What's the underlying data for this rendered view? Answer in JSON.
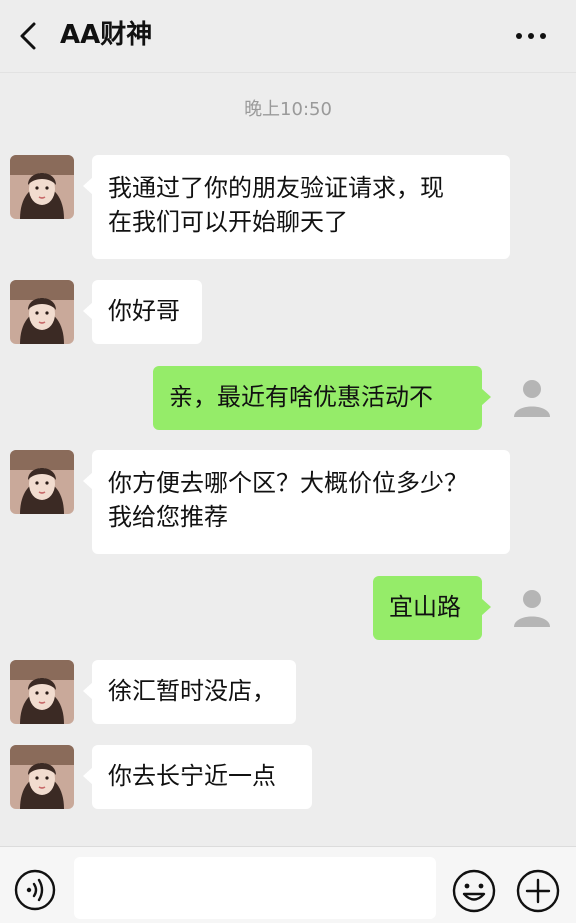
{
  "header": {
    "title": "AA财神"
  },
  "timestamp": "晚上10:50",
  "messages": [
    {
      "side": "left",
      "lines": [
        "我通过了你的朋友验证请求，现",
        "在我们可以开始聊天了"
      ]
    },
    {
      "side": "left",
      "lines": [
        "你好哥"
      ]
    },
    {
      "side": "right",
      "lines": [
        "亲，最近有啥优惠活动不"
      ]
    },
    {
      "side": "left",
      "lines": [
        "你方便去哪个区？大概价位多少？",
        "我给您推荐"
      ]
    },
    {
      "side": "right",
      "lines": [
        "宜山路"
      ]
    },
    {
      "side": "left",
      "lines": [
        "徐汇暂时没店，"
      ]
    },
    {
      "side": "left",
      "lines": [
        "你去长宁近一点"
      ]
    }
  ],
  "icons": {
    "back": "chevron-left-icon",
    "more": "more-dots-icon",
    "voice": "voice-icon",
    "emoji": "emoji-icon",
    "plus": "plus-icon"
  },
  "colors": {
    "background": "#ededed",
    "bubble_received": "#ffffff",
    "bubble_sent": "#95ec69",
    "timestamp": "#9a9a9a"
  }
}
